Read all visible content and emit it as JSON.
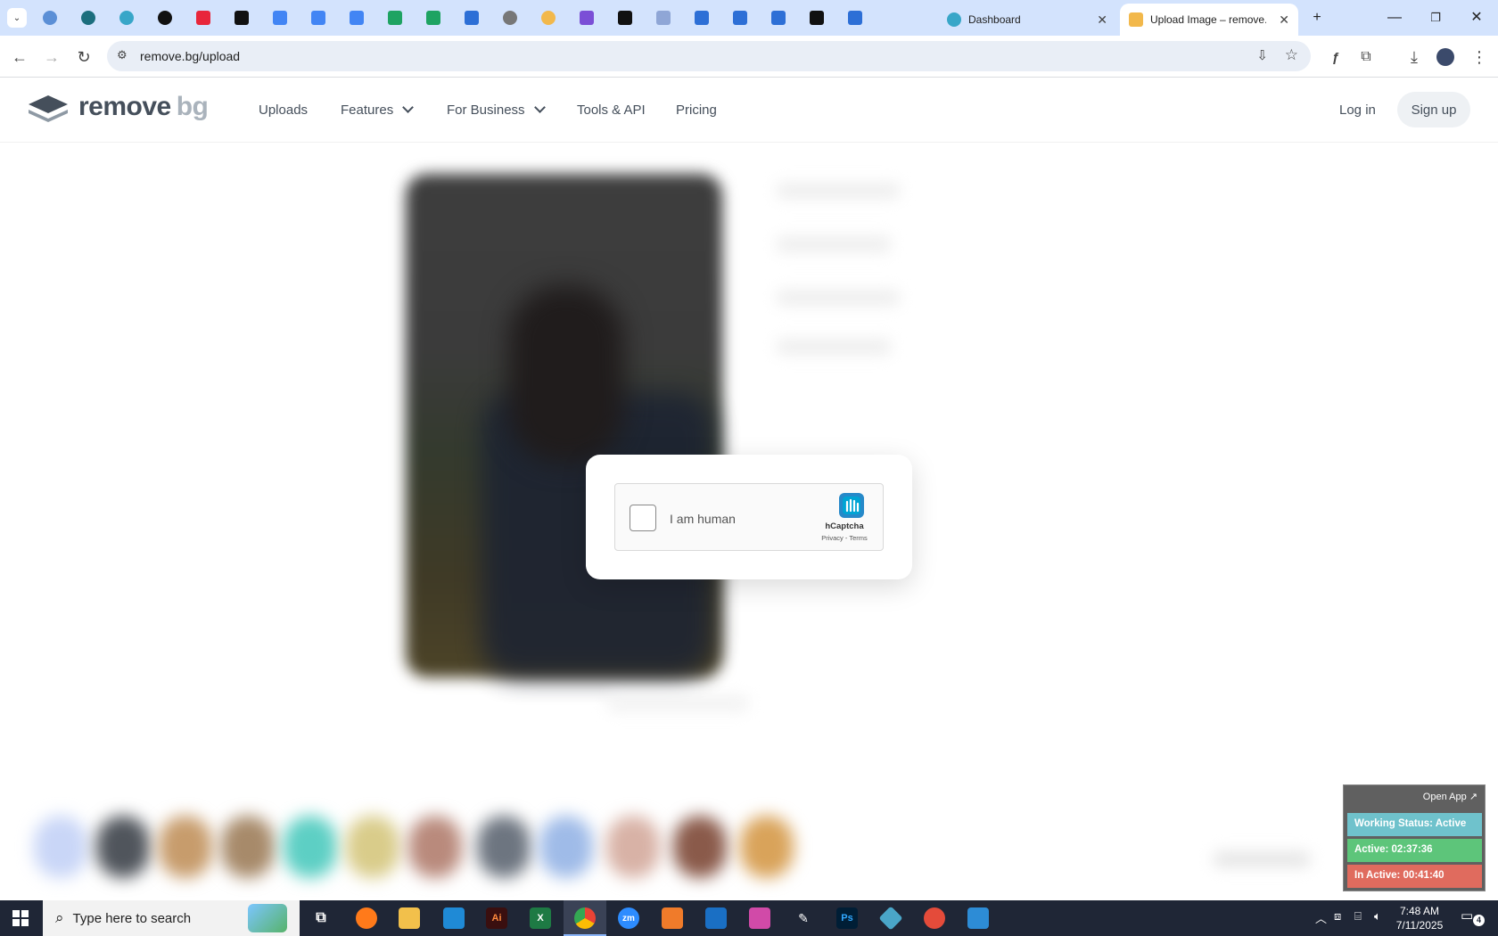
{
  "browser": {
    "tabs": [
      {
        "title": "Dashboard"
      },
      {
        "title": "Upload Image – remove.",
        "active": true
      }
    ],
    "url": "remove.bg/upload"
  },
  "site": {
    "logo_word1": "remove",
    "logo_word2": "bg",
    "nav": [
      "Uploads",
      "Features",
      "For Business",
      "Tools & API",
      "Pricing"
    ],
    "login": "Log in",
    "signup": "Sign up"
  },
  "captcha": {
    "label": "I am human",
    "brand": "hCaptcha",
    "links": "Privacy - Terms"
  },
  "widget": {
    "open_app": "Open App ↗",
    "status": "Working Status: Active",
    "active": "Active: 02:37:36",
    "inactive": "In Active: 00:41:40",
    "colors": {
      "status": "#6fc2cc",
      "active": "#5dc57a",
      "inactive": "#e06b5e"
    }
  },
  "taskbar": {
    "search_placeholder": "Type here to search",
    "time": "7:48 AM",
    "date": "7/11/2025",
    "notification_count": "4"
  },
  "colors": {
    "accent": "#454f5b",
    "tab_bar": "#d3e3fd",
    "taskbar": "#1f2636"
  }
}
